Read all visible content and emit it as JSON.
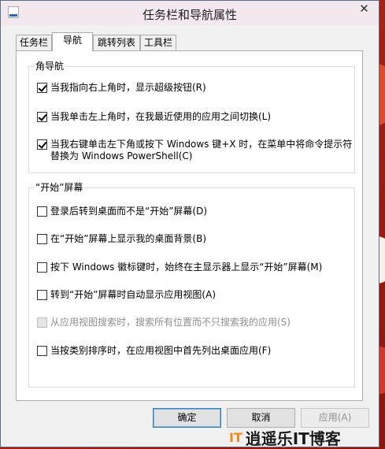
{
  "window": {
    "title": "任务栏和导航属性",
    "close_glyph": "✕"
  },
  "tabs": [
    {
      "label": "任务栏"
    },
    {
      "label": "导航",
      "selected": true
    },
    {
      "label": "跳转列表"
    },
    {
      "label": "工具栏"
    }
  ],
  "corner_nav": {
    "title": "角导航",
    "options": [
      {
        "label": "当我指向右上角时，显示超级按钮(R)",
        "checked": true
      },
      {
        "label": "当我单击左上角时，在我最近使用的应用之间切换(L)",
        "checked": true
      },
      {
        "label": "当我右键单击左下角或按下 Windows 键+X 时，在菜单中将命令提示符替换为 Windows PowerShell(C)",
        "checked": true
      }
    ]
  },
  "start_screen": {
    "title": "“开始”屏幕",
    "options": [
      {
        "label": "登录后转到桌面而不是“开始”屏幕(D)",
        "checked": false
      },
      {
        "label": "在“开始”屏幕上显示我的桌面背景(B)",
        "checked": false
      },
      {
        "label": "按下 Windows 徽标键时，始终在主显示器上显示“开始”屏幕(M)",
        "checked": false
      },
      {
        "label": "转到“开始”屏幕时自动显示应用视图(A)",
        "checked": false
      },
      {
        "label": "从应用视图搜索时，搜索所有位置而不只搜索我的应用(S)",
        "checked": false,
        "disabled": true
      },
      {
        "label": "当按类别排序时，在应用视图中首先列出桌面应用(F)",
        "checked": false
      }
    ]
  },
  "buttons": {
    "ok": "确定",
    "cancel": "取消",
    "apply": "应用(A)"
  },
  "watermark": {
    "logo": "IT",
    "text": "逍遥乐IT博客"
  }
}
